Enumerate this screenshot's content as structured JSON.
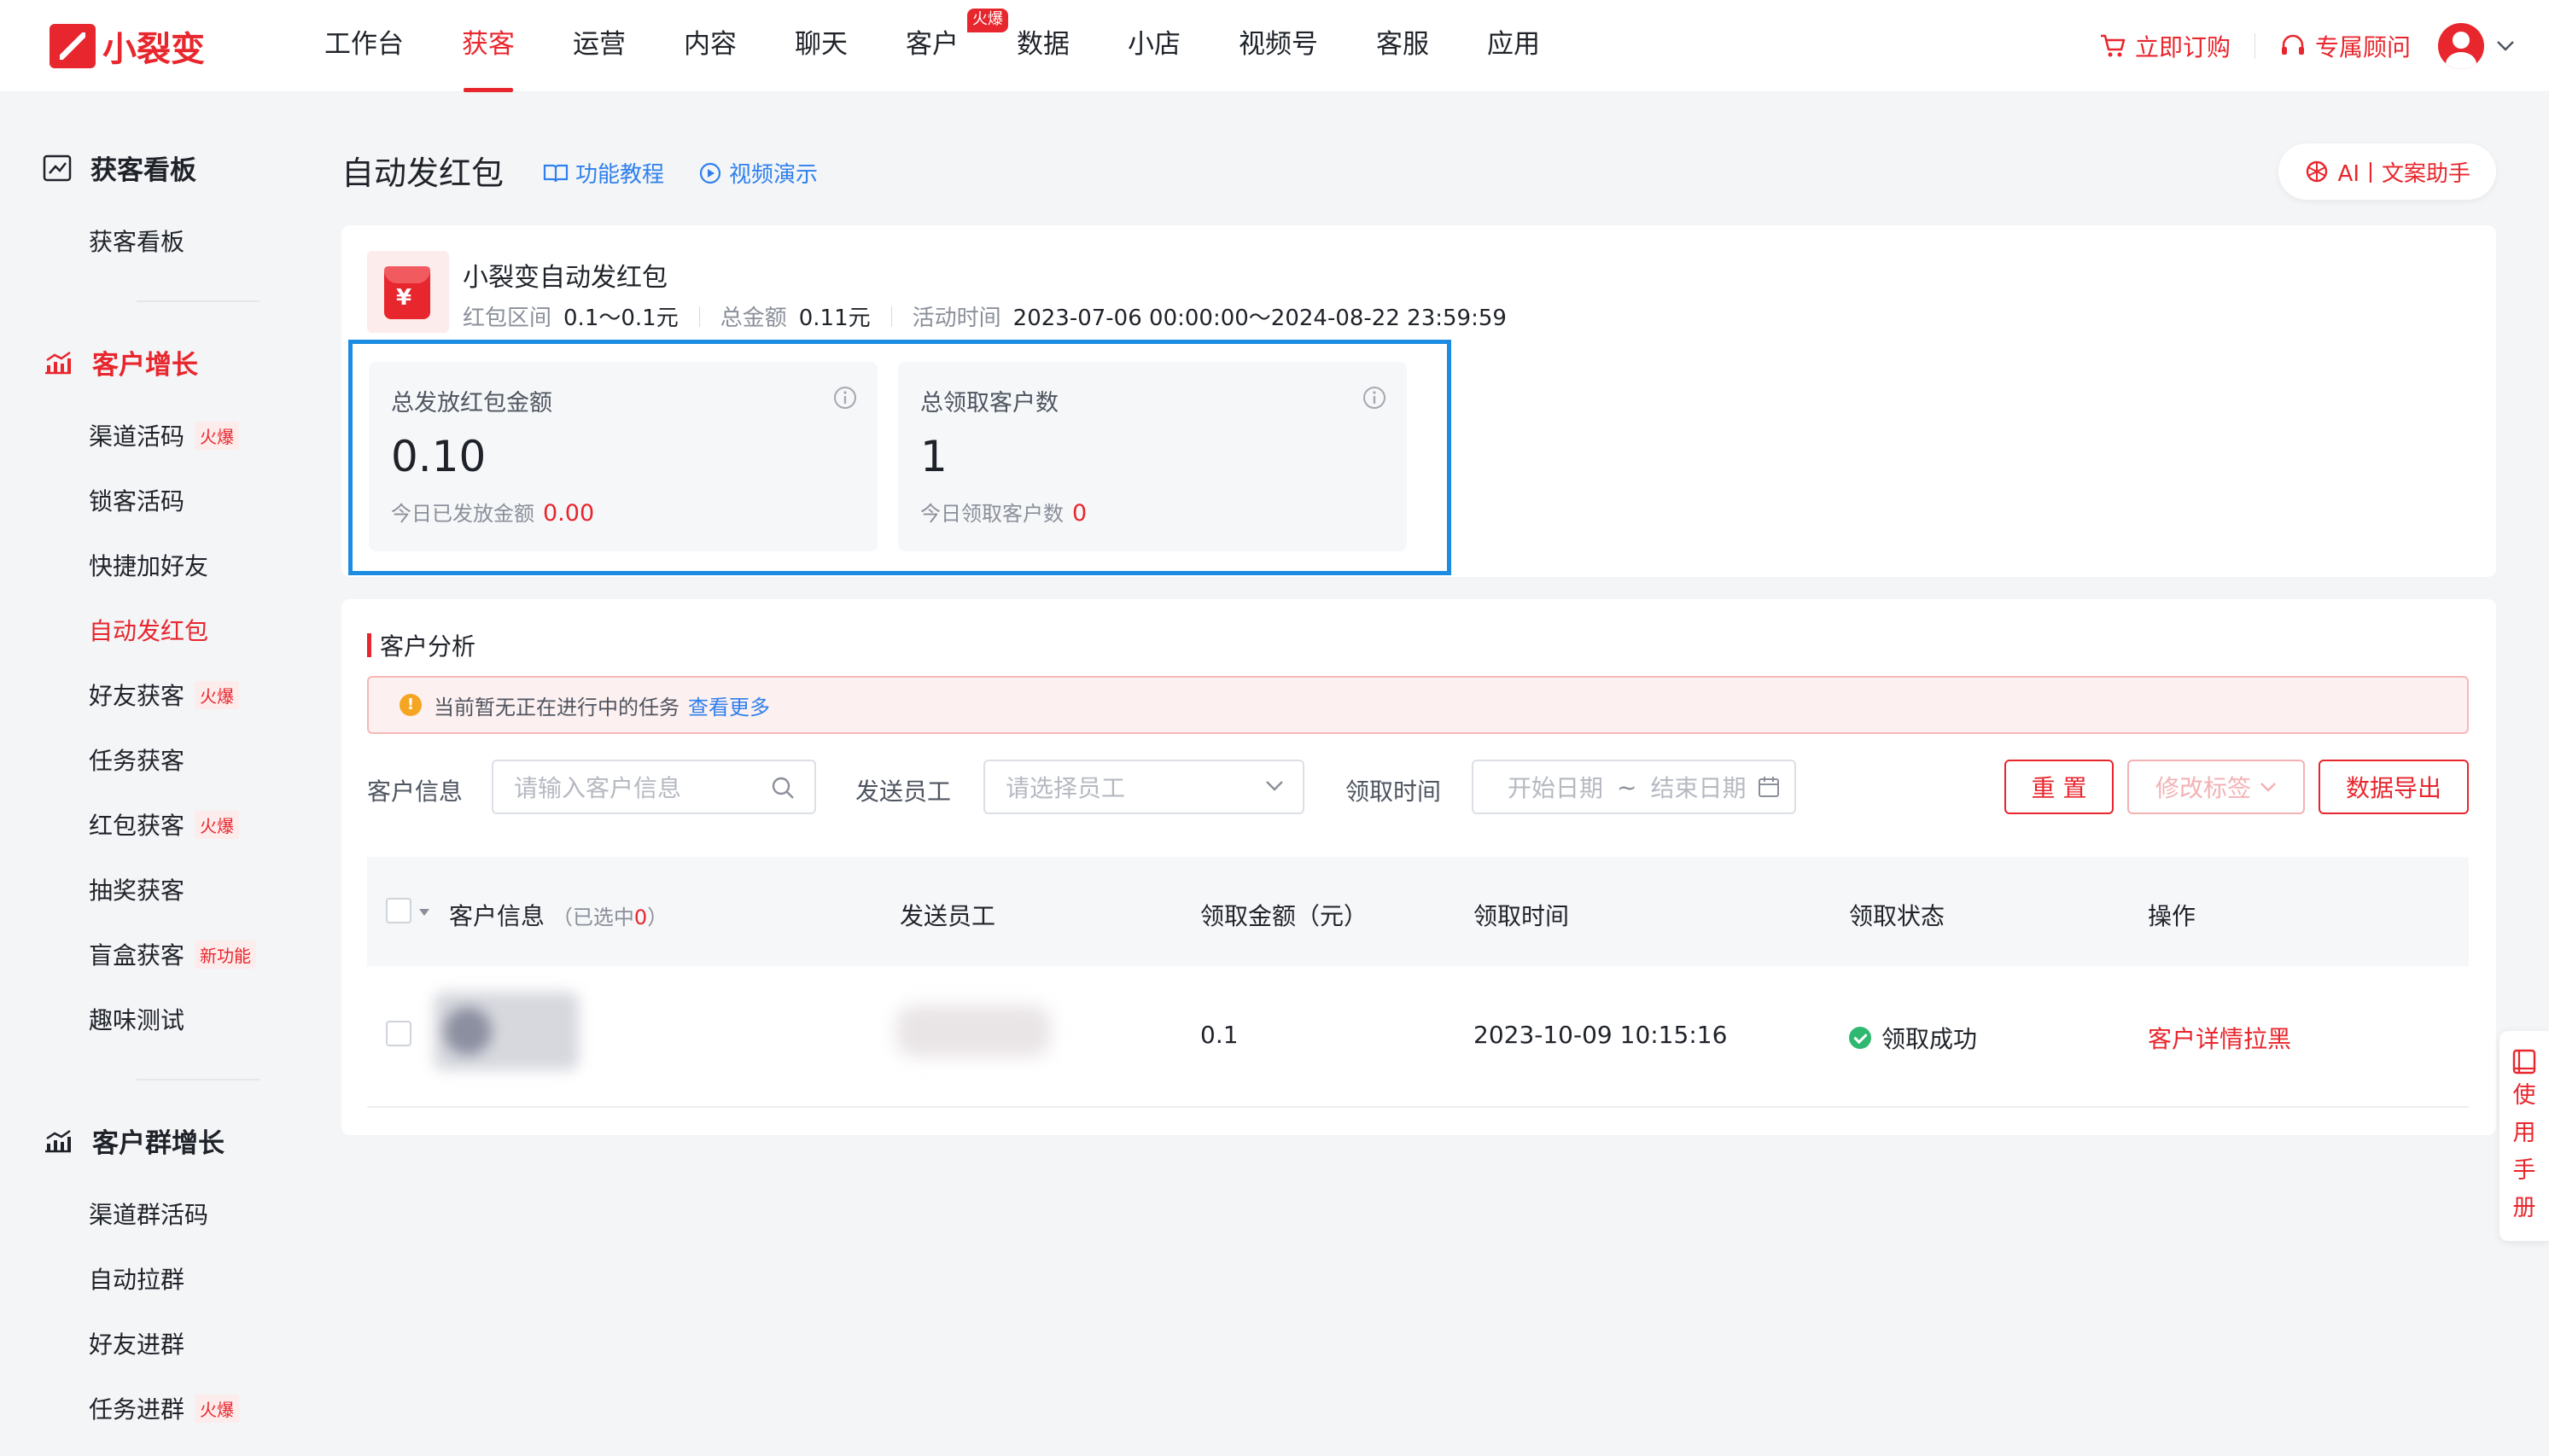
{
  "brand": {
    "name": "小裂变",
    "accent": "#e8262d",
    "highlight": "#1c8ce3"
  },
  "nav": {
    "items": [
      {
        "label": "工作台"
      },
      {
        "label": "获客",
        "active": true
      },
      {
        "label": "运营"
      },
      {
        "label": "内容"
      },
      {
        "label": "聊天"
      },
      {
        "label": "客户",
        "badge": "火爆"
      },
      {
        "label": "数据"
      },
      {
        "label": "小店"
      },
      {
        "label": "视频号"
      },
      {
        "label": "客服"
      },
      {
        "label": "应用"
      }
    ],
    "subscribe": "立即订购",
    "advisor": "专属顾问"
  },
  "sidebar": {
    "groups": [
      {
        "title": "获客看板",
        "items": [
          {
            "label": "获客看板"
          }
        ]
      },
      {
        "title": "客户增长",
        "items": [
          {
            "label": "渠道活码",
            "tag": "火爆"
          },
          {
            "label": "锁客活码"
          },
          {
            "label": "快捷加好友"
          },
          {
            "label": "自动发红包",
            "active": true
          },
          {
            "label": "好友获客",
            "tag": "火爆"
          },
          {
            "label": "任务获客"
          },
          {
            "label": "红包获客",
            "tag": "火爆"
          },
          {
            "label": "抽奖获客"
          },
          {
            "label": "盲盒获客",
            "tag": "新功能"
          },
          {
            "label": "趣味测试"
          }
        ]
      },
      {
        "title": "客户群增长",
        "items": [
          {
            "label": "渠道群活码"
          },
          {
            "label": "自动拉群"
          },
          {
            "label": "好友进群"
          },
          {
            "label": "任务进群",
            "tag": "火爆"
          }
        ]
      }
    ]
  },
  "page": {
    "title": "自动发红包",
    "tutorial": "功能教程",
    "video": "视频演示",
    "ai": "AI丨文案助手"
  },
  "campaign": {
    "name": "小裂变自动发红包",
    "range_label": "红包区间",
    "range_value": "0.1～0.1元",
    "total_label": "总金额",
    "total_value": "0.11元",
    "time_label": "活动时间",
    "time_value": "2023-07-06 00:00:00～2024-08-22 23:59:59"
  },
  "stats": [
    {
      "label": "总发放红包金额",
      "value": "0.10",
      "sub_label": "今日已发放金额",
      "sub_value": "0.00"
    },
    {
      "label": "总领取客户数",
      "value": "1",
      "sub_label": "今日领取客户数",
      "sub_value": "0"
    }
  ],
  "analysis": {
    "title": "客户分析",
    "alert": "当前暂无正在进行中的任务",
    "alert_link": "查看更多",
    "filters": {
      "customer_label": "客户信息",
      "customer_placeholder": "请输入客户信息",
      "staff_label": "发送员工",
      "staff_placeholder": "请选择员工",
      "time_label": "领取时间",
      "start_placeholder": "开始日期",
      "range_sep": "~",
      "end_placeholder": "结束日期"
    },
    "buttons": {
      "reset": "重 置",
      "edit_tags": "修改标签",
      "export": "数据导出"
    },
    "table": {
      "columns": [
        "客户信息",
        "发送员工",
        "领取金额（元）",
        "领取时间",
        "领取状态",
        "操作"
      ],
      "selected_prefix": "（已选中",
      "selected_count": "0",
      "selected_suffix": "）",
      "rows": [
        {
          "amount": "0.1",
          "time": "2023-10-09 10:15:16",
          "status": "领取成功",
          "actions": "客户详情拉黑"
        }
      ]
    }
  },
  "manual": {
    "chars": [
      "使",
      "用",
      "手",
      "册"
    ]
  }
}
